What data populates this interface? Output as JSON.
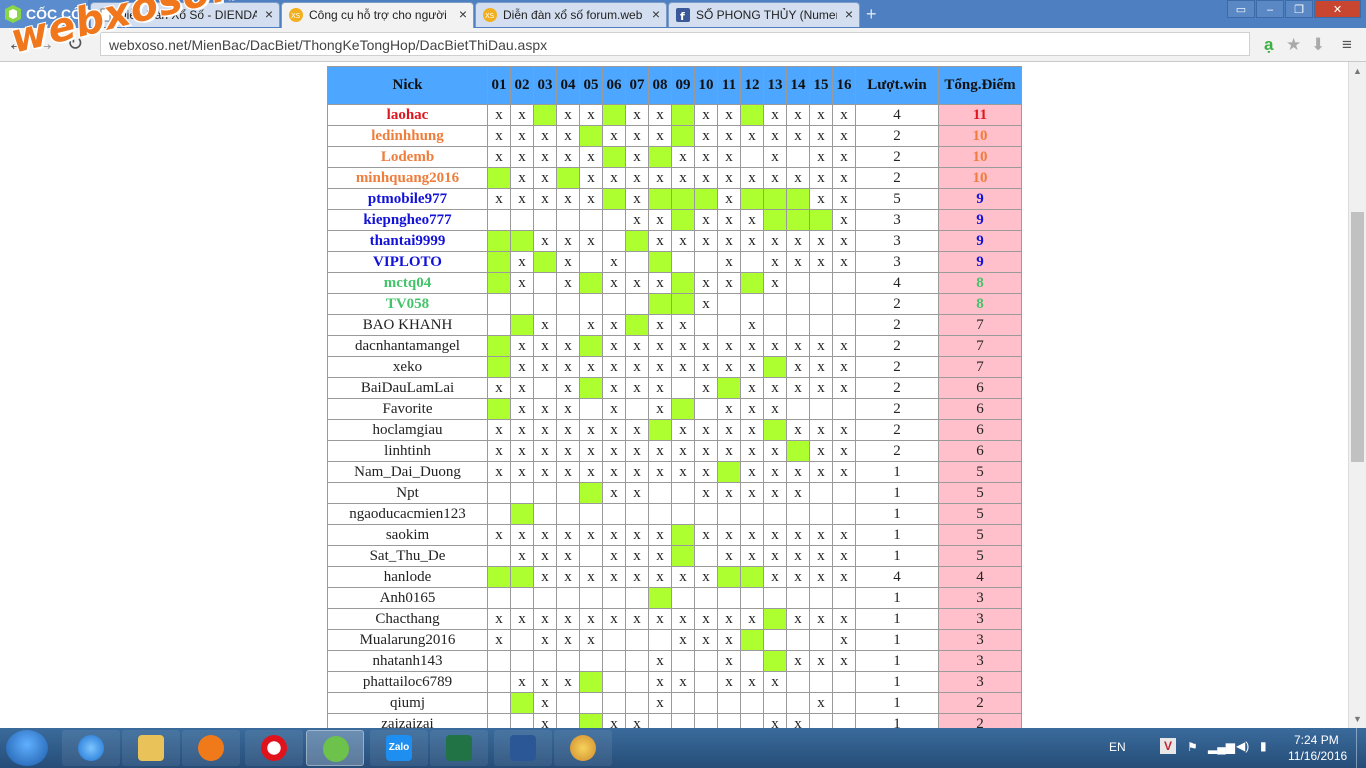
{
  "browser": {
    "logo_text": "CỐC CỐC",
    "tabs": [
      {
        "title": "Diễn Đàn Xổ Số - DIENDAN",
        "icon": "page-icon"
      },
      {
        "title": "Công cụ hỗ trợ cho người",
        "icon": "xs-icon",
        "active": true
      },
      {
        "title": "Diễn đàn xổ số forum.web",
        "icon": "xs-icon"
      },
      {
        "title": "SỐ PHONG THỦY (Numero",
        "icon": "facebook-icon"
      }
    ],
    "url": "webxoso.net/MienBac/DacBiet/ThongKeTongHop/DacBietThiDau.aspx",
    "watermark": "webxoso.net"
  },
  "table": {
    "headers": [
      "Nick",
      "01",
      "02",
      "03",
      "04",
      "05",
      "06",
      "07",
      "08",
      "09",
      "10",
      "11",
      "12",
      "13",
      "14",
      "15",
      "16",
      "Lượt.win",
      "Tổng.Điểm"
    ],
    "colors": {
      "green": "#adff2f",
      "header": "#4da6ff",
      "score_bg": "#ffc0cb"
    },
    "rows": [
      {
        "nick": "laohac",
        "style": "red",
        "cells": "xxgxxgxxgxxgxxxx",
        "win": "4",
        "score": "11"
      },
      {
        "nick": "ledinhhung",
        "style": "orange",
        "cells": "xxxxgxxxgxxxxxxx",
        "win": "2",
        "score": "10"
      },
      {
        "nick": "Lodemb",
        "style": "orange",
        "cells": "xxxxxgxgxxx.x.xx",
        "win": "2",
        "score": "10"
      },
      {
        "nick": "minhquang2016",
        "style": "orange",
        "cells": "gxxgxxxxxxxxxxxx",
        "win": "2",
        "score": "10"
      },
      {
        "nick": "ptmobile977",
        "style": "blue",
        "cells": "xxxxxgxgggxgggxx",
        "win": "5",
        "score": "9"
      },
      {
        "nick": "kiepngheo777",
        "style": "blue",
        "cells": "......xxgxxxgggx",
        "win": "3",
        "score": "9"
      },
      {
        "nick": "thantai9999",
        "style": "blue",
        "cells": "ggxxx.gxxxxxxxxx",
        "win": "3",
        "score": "9"
      },
      {
        "nick": "VIPLOTO",
        "style": "blue",
        "cells": "gxgx.x.g..x.xxxx",
        "win": "3",
        "score": "9"
      },
      {
        "nick": "mctq04",
        "style": "green",
        "cells": "gx.xgxxxgxxgx...",
        "win": "4",
        "score": "8"
      },
      {
        "nick": "TV058",
        "style": "green",
        "cells": ".......ggx......",
        "win": "2",
        "score": "8"
      },
      {
        "nick": "BAO KHANH",
        "style": "plain",
        "cells": ".gx.xxgxx..x....",
        "win": "2",
        "score": "7"
      },
      {
        "nick": "dacnhantamangel",
        "style": "plain",
        "cells": "gxxxgxxxxxxxxxxx",
        "win": "2",
        "score": "7"
      },
      {
        "nick": "xeko",
        "style": "plain",
        "cells": "gxxxxxxxxxxxgxxx",
        "win": "2",
        "score": "7"
      },
      {
        "nick": "BaiDauLamLai",
        "style": "plain",
        "cells": "xx.xgxxx.xgxxxxx",
        "win": "2",
        "score": "6"
      },
      {
        "nick": "Favorite",
        "style": "plain",
        "cells": "gxxx.x.xg.xxx...",
        "win": "2",
        "score": "6"
      },
      {
        "nick": "hoclamgiau",
        "style": "plain",
        "cells": "xxxxxxxgxxxxgxxx",
        "win": "2",
        "score": "6"
      },
      {
        "nick": "linhtinh",
        "style": "plain",
        "cells": "xxxxxxxxxxxxxgxx",
        "win": "2",
        "score": "6"
      },
      {
        "nick": "Nam_Dai_Duong",
        "style": "plain",
        "cells": "xxxxxxxxxxgxxxxx",
        "win": "1",
        "score": "5"
      },
      {
        "nick": "Npt",
        "style": "plain",
        "cells": "....gxx..xxxxx..",
        "win": "1",
        "score": "5"
      },
      {
        "nick": "ngaoducacmien123",
        "style": "plain",
        "cells": ".g..............",
        "win": "1",
        "score": "5"
      },
      {
        "nick": "saokim",
        "style": "plain",
        "cells": "xxxxxxxxgxxxxxxx",
        "win": "1",
        "score": "5"
      },
      {
        "nick": "Sat_Thu_De",
        "style": "plain",
        "cells": ".xxx.xxxg.xxxxxx",
        "win": "1",
        "score": "5"
      },
      {
        "nick": "hanlode",
        "style": "plain",
        "cells": "ggxxxxxxxxggxxxx",
        "win": "4",
        "score": "4"
      },
      {
        "nick": "Anh0165",
        "style": "plain",
        "cells": ".......g........",
        "win": "1",
        "score": "3"
      },
      {
        "nick": "Chacthang",
        "style": "plain",
        "cells": "xxxxxxxxxxxxgxxx",
        "win": "1",
        "score": "3"
      },
      {
        "nick": "Mualarung2016",
        "style": "plain",
        "cells": "x.xxx...xxxg...x",
        "win": "1",
        "score": "3"
      },
      {
        "nick": "nhatanh143",
        "style": "plain",
        "cells": ".......x..x.gxxx",
        "win": "1",
        "score": "3"
      },
      {
        "nick": "phattailoc6789",
        "style": "plain",
        "cells": ".xxxg..xx.xxx...",
        "win": "1",
        "score": "3"
      },
      {
        "nick": "qiumj",
        "style": "plain",
        "cells": ".gx....x......x.",
        "win": "1",
        "score": "2"
      },
      {
        "nick": "zaizaizai",
        "style": "plain",
        "cells": "..x.gxx.....xx..",
        "win": "1",
        "score": "2"
      }
    ]
  },
  "taskbar": {
    "apps": [
      "ie-icon",
      "explorer-icon",
      "media-icon",
      "opera-icon",
      "coccoc-icon",
      "zalo-icon",
      "excel-icon",
      "word-icon",
      "paint-icon"
    ],
    "zalo_label": "Zalo",
    "lang": "EN",
    "time": "7:24 PM",
    "date": "11/16/2016"
  }
}
